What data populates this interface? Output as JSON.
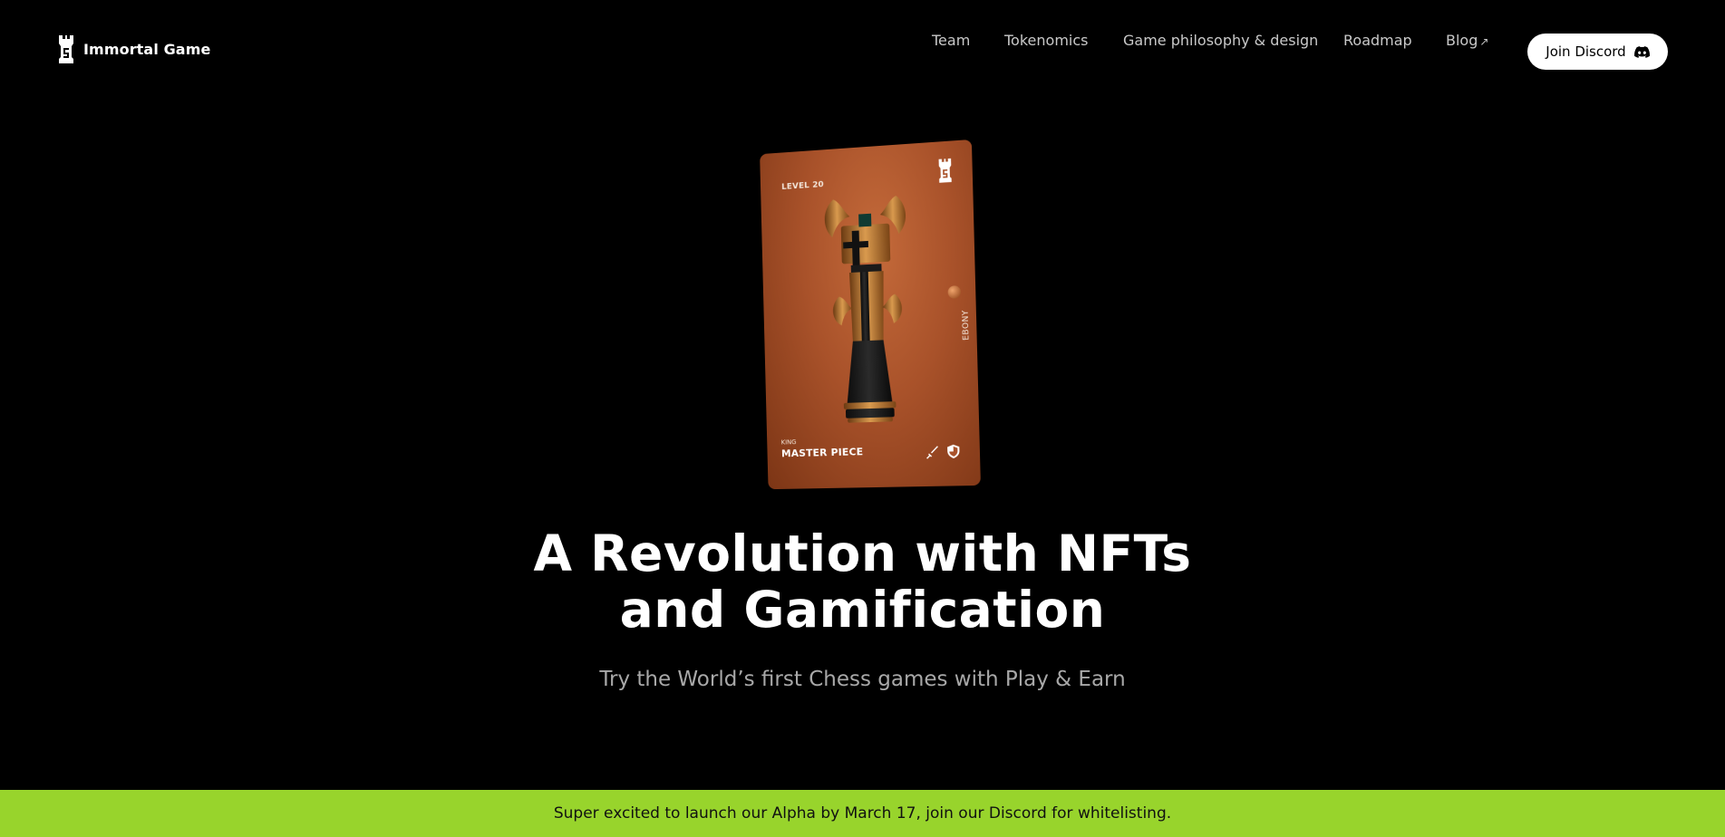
{
  "brand": {
    "name": "Immortal Game",
    "icon": "rook-logo-icon"
  },
  "nav": {
    "items": [
      {
        "label": "Team"
      },
      {
        "label": "Tokenomics"
      },
      {
        "label": "Game philosophy & design"
      },
      {
        "label": "Roadmap"
      },
      {
        "label": "Blog",
        "icon": "arrow-up-right-icon",
        "arrow": "↗"
      }
    ],
    "cta": {
      "label": "Join Discord",
      "icon": "discord-icon"
    }
  },
  "card": {
    "level": "LEVEL 20",
    "wood": "EBONY",
    "piece_type": "KING",
    "piece_name": "MASTER PIECE",
    "icons": [
      "rook-logo-icon",
      "sword-icon",
      "shield-icon"
    ]
  },
  "hero": {
    "title_line1": "A Revolution with NFTs",
    "title_line2": "and Gamification",
    "subtitle": "Try the World’s first Chess games with Play & Earn"
  },
  "banner": {
    "text": "Super excited to launch our Alpha by March 17, join our Discord for whitelisting."
  },
  "colors": {
    "background": "#000000",
    "banner": "#98d42c",
    "card": "#a9522a",
    "button": "#ffffff"
  }
}
